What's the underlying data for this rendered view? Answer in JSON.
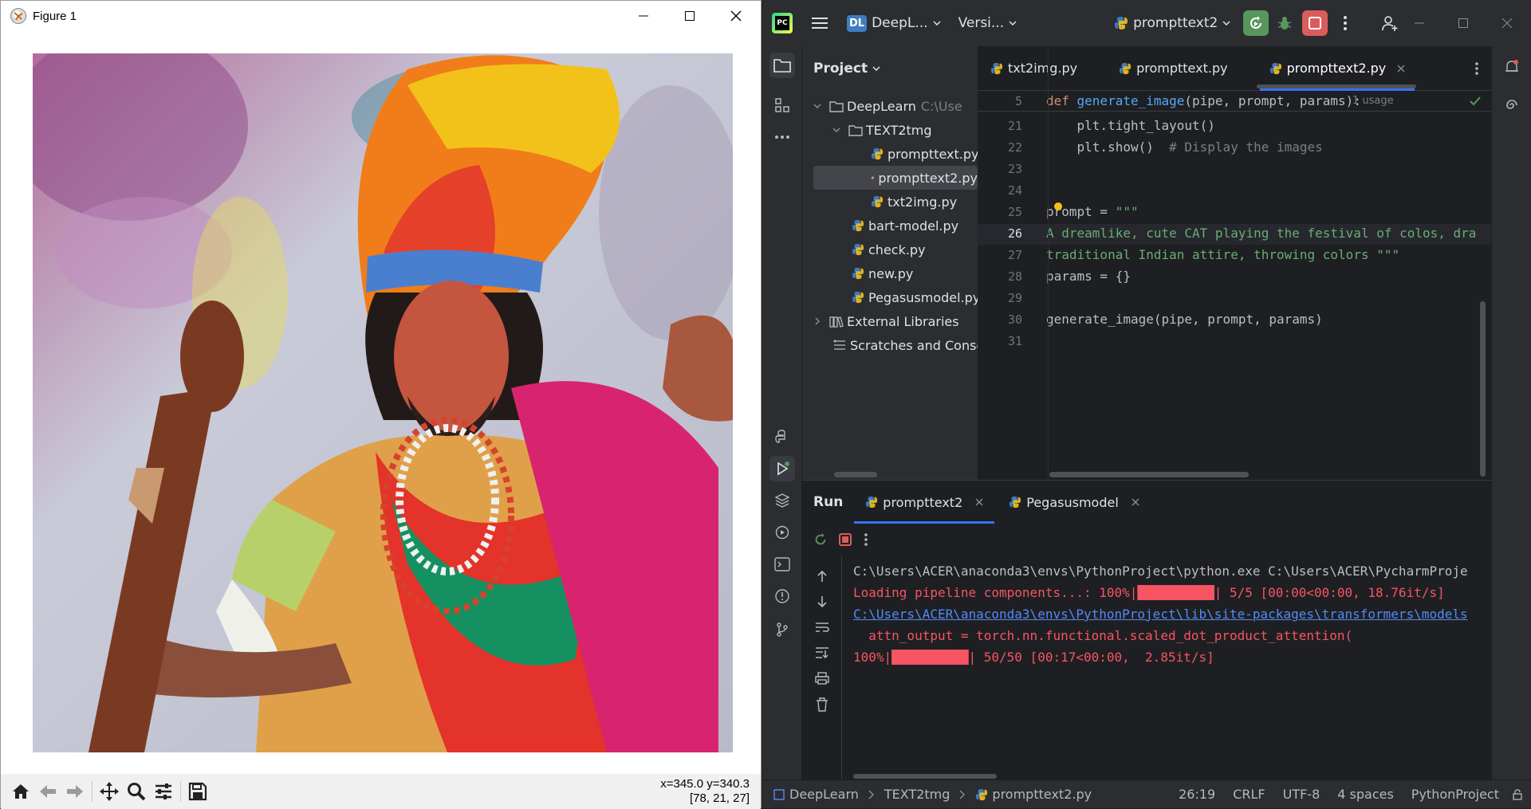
{
  "figure_window": {
    "title": "Figure 1",
    "coords": {
      "line1": "x=345.0 y=340.3",
      "line2": "[78, 21, 27]"
    }
  },
  "ide": {
    "titlebar": {
      "logo": "PC",
      "project_badge": "DL",
      "project_name": "DeepL...",
      "vcs": "Versi...",
      "run_config": "prompttext2"
    },
    "project_panel": {
      "title": "Project",
      "tree": [
        {
          "label": "DeepLearn",
          "hint": "C:\\Use",
          "type": "folder"
        },
        {
          "label": "TEXT2tmg",
          "type": "folder"
        },
        {
          "label": "prompttext.py",
          "type": "py"
        },
        {
          "label": "prompttext2.py",
          "type": "py"
        },
        {
          "label": "txt2img.py",
          "type": "py"
        },
        {
          "label": "bart-model.py",
          "type": "py"
        },
        {
          "label": "check.py",
          "type": "py"
        },
        {
          "label": "new.py",
          "type": "py"
        },
        {
          "label": "Pegasusmodel.py",
          "type": "py"
        },
        {
          "label": "External Libraries",
          "type": "lib"
        },
        {
          "label": "Scratches and Consoles",
          "type": "scratch"
        }
      ]
    },
    "editor": {
      "tabs": [
        "txt2img.py",
        "prompttext.py",
        "prompttext2.py"
      ],
      "active_tab": "prompttext2.py",
      "sticky_line": {
        "num": "5",
        "kw": "def ",
        "fn": "generate_image",
        "rest": "(pipe, prompt, params):",
        "usage": "1 usage"
      },
      "lines": [
        {
          "num": "21",
          "code": "    plt.tight_layout()",
          "comment": ""
        },
        {
          "num": "22",
          "code": "    plt.show()  ",
          "comment": "# Display the images"
        },
        {
          "num": "23",
          "code": "",
          "comment": ""
        },
        {
          "num": "24",
          "code": "",
          "comment": ""
        },
        {
          "num": "25",
          "code": "prompt = ",
          "string": "\"\"\""
        },
        {
          "num": "26",
          "string": "A dreamlike, cute CAT playing the festival of colos, dra"
        },
        {
          "num": "27",
          "string": "traditional Indian attire, throwing colors \"\"\""
        },
        {
          "num": "28",
          "code": "params = {}"
        },
        {
          "num": "29",
          "code": ""
        },
        {
          "num": "30",
          "code": "generate_image(pipe, prompt, params)"
        },
        {
          "num": "31",
          "code": ""
        }
      ]
    },
    "run_panel": {
      "title": "Run",
      "tabs": [
        "prompttext2",
        "Pegasusmodel"
      ],
      "output": [
        "C:\\Users\\ACER\\anaconda3\\envs\\PythonProject\\python.exe C:\\Users\\ACER\\PycharmProje",
        "Loading pipeline components...: 100%|██████████| 5/5 [00:00<00:00, 18.76it/s]",
        "C:\\Users\\ACER\\anaconda3\\envs\\PythonProject\\lib\\site-packages\\transformers\\models",
        "  attn_output = torch.nn.functional.scaled_dot_product_attention(",
        "100%|██████████| 50/50 [00:17<00:00,  2.85it/s]"
      ]
    },
    "status_bar": {
      "breadcrumbs": [
        "DeepLearn",
        "TEXT2tmg",
        "prompttext2.py"
      ],
      "position": "26:19",
      "line_sep": "CRLF",
      "encoding": "UTF-8",
      "indent": "4 spaces",
      "interpreter": "PythonProject"
    },
    "colors": {
      "accent": "#3574f0",
      "run_green": "#57965c",
      "stop_red": "#db5c5c",
      "error_red": "#f75464",
      "string_green": "#6aab73"
    }
  }
}
